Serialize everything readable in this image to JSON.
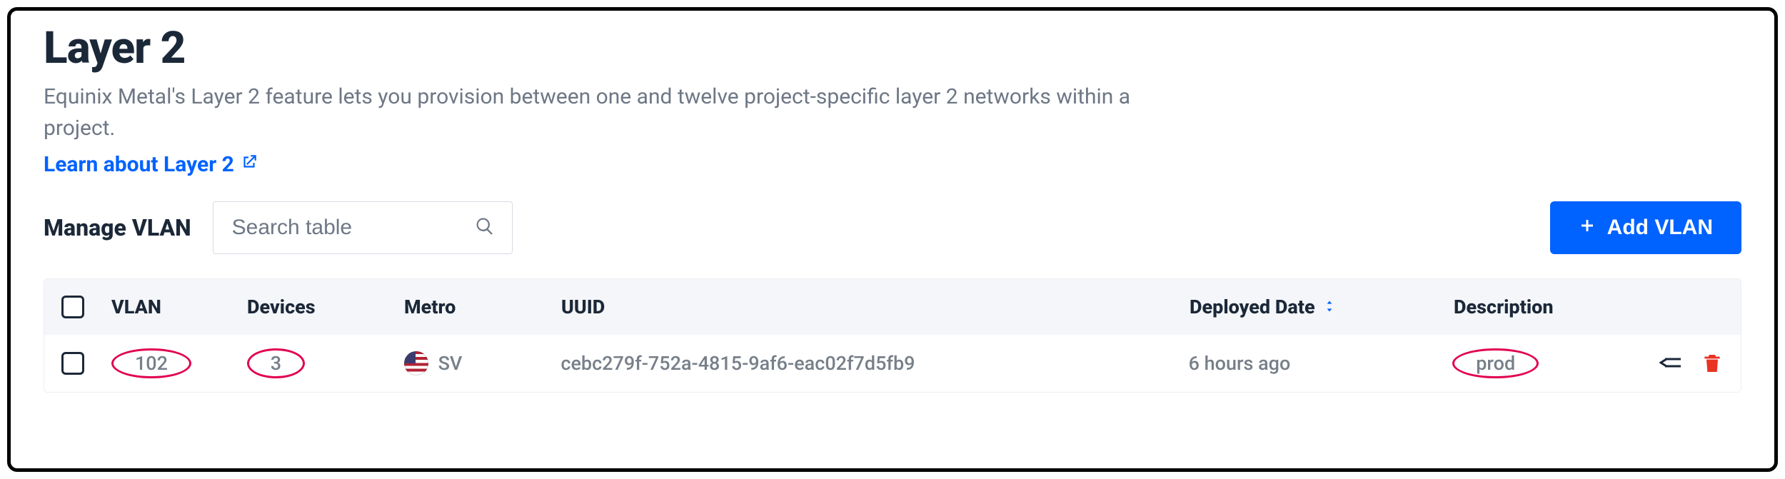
{
  "page": {
    "title": "Layer 2",
    "description_line1": "Equinix Metal's Layer 2 feature lets you provision between one and twelve project-specific layer 2 networks within a",
    "description_line2": "project.",
    "learn_link": "Learn about Layer 2"
  },
  "toolbar": {
    "manage_label": "Manage VLAN",
    "search_placeholder": "Search table",
    "add_button": "Add VLAN"
  },
  "table": {
    "headers": {
      "vlan": "VLAN",
      "devices": "Devices",
      "metro": "Metro",
      "uuid": "UUID",
      "deployed_date": "Deployed Date",
      "description": "Description"
    },
    "rows": [
      {
        "vlan": "102",
        "devices": "3",
        "metro": "SV",
        "metro_flag": "US",
        "uuid": "cebc279f-752a-4815-9af6-eac02f7d5fb9",
        "deployed_date": "6 hours ago",
        "description": "prod"
      }
    ]
  }
}
